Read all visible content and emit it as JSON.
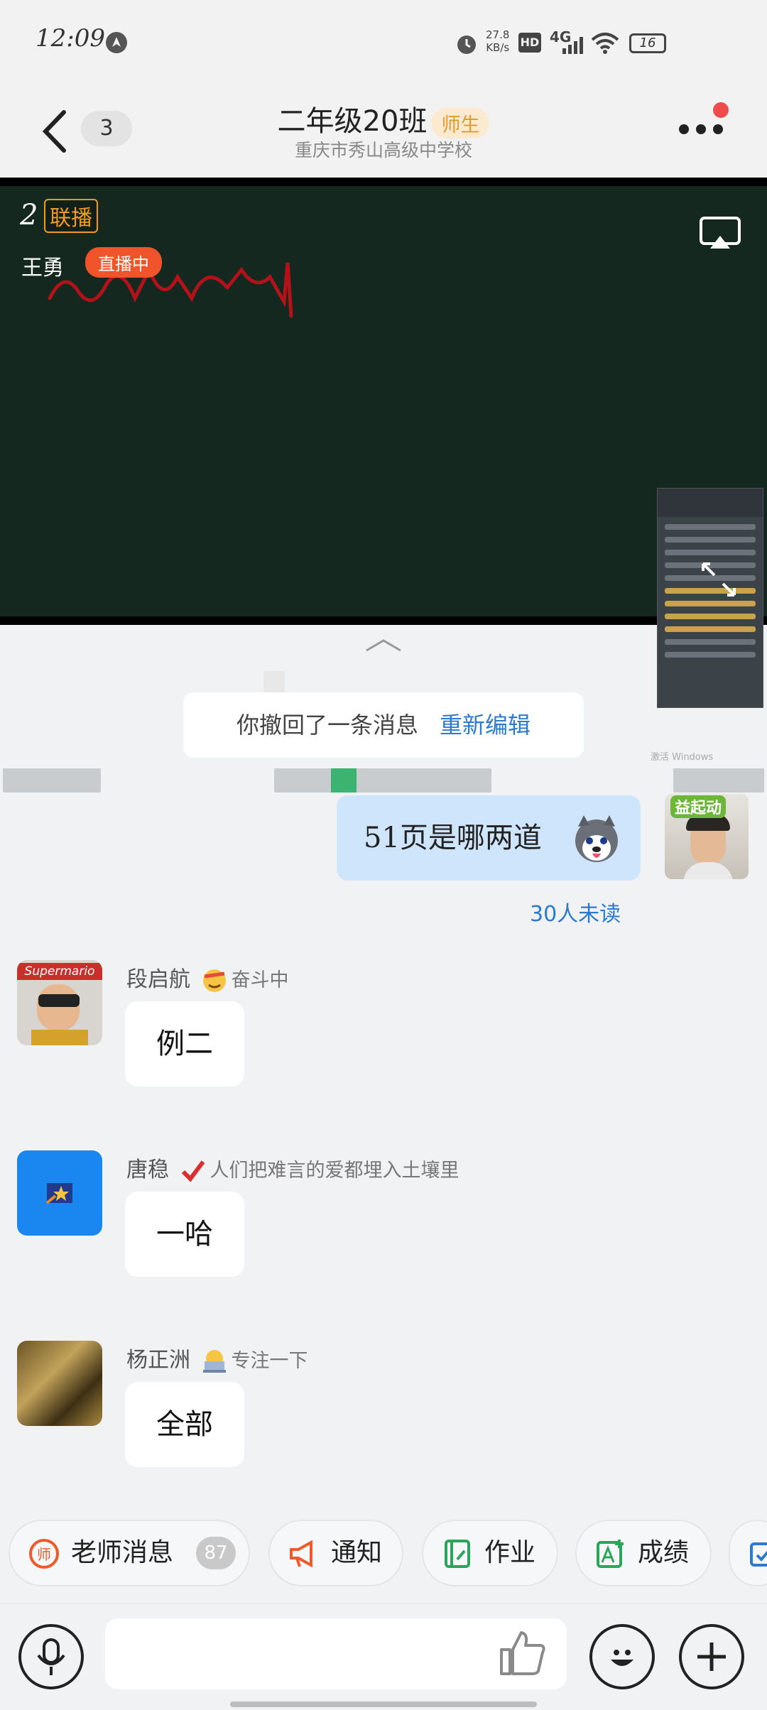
{
  "status_bar": {
    "time": "12:09",
    "net_speed": "27.8",
    "net_speed_unit": "KB/s",
    "hd": "HD",
    "network": "4G",
    "battery": "16"
  },
  "header": {
    "unread_count": "3",
    "title": "二年级20班",
    "tag": "师生",
    "subtitle": "重庆市秀山高级中学校"
  },
  "live": {
    "number": "2",
    "tag": "联播",
    "teacher": "王勇",
    "status": "直播中",
    "windows_notice": "激活 Windows"
  },
  "chat": {
    "system_message": "你撤回了一条消息",
    "system_action": "重新编辑",
    "my_message": "51页是哪两道",
    "unread_info": "30人未读",
    "avatar_badge": "益起动",
    "messages": [
      {
        "name": "段启航",
        "signature": "奋斗中",
        "text": "例二",
        "avatar_text": "Supermario"
      },
      {
        "name": "唐稳",
        "signature": "人们把难言的爱都埋入土壤里",
        "text": "一哈"
      },
      {
        "name": "杨正洲",
        "signature": "专注一下",
        "text": "全部"
      }
    ]
  },
  "quickbar": {
    "teacher_msg": "老师消息",
    "teacher_count": "87",
    "notice": "通知",
    "homework": "作业",
    "grades": "成绩"
  },
  "colors": {
    "accent_blue": "#2a7bd0",
    "bubble_blue": "#cfe5fb",
    "live_red": "#f0542a",
    "tag_orange": "#f39a1f"
  }
}
